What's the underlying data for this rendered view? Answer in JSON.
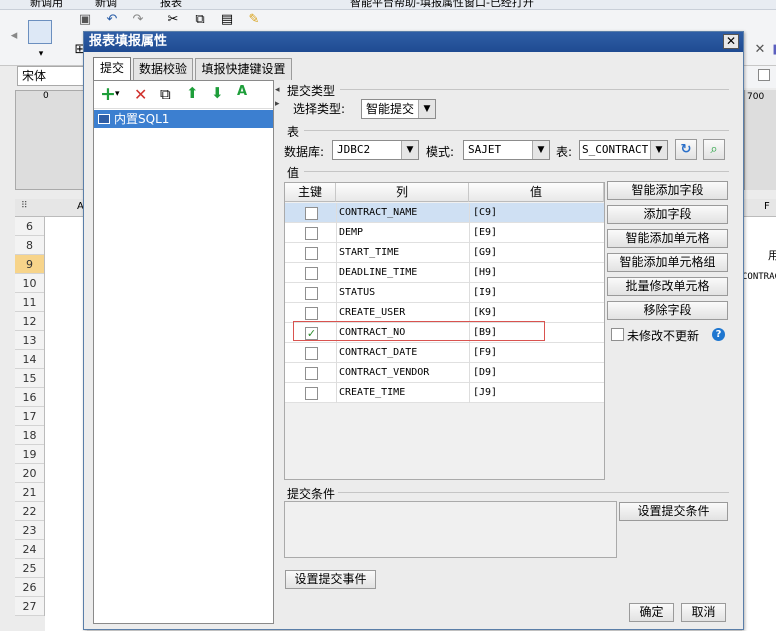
{
  "app": {
    "menu_items": [
      "新调用",
      "新调",
      "报表"
    ],
    "title_text": "智能平台帮助-填报属性窗口-已经打开",
    "font_name": "宋体",
    "ruler_left": "0",
    "ruler_right": "700",
    "col_a": "A",
    "col_f": "F",
    "right_cell_1": "用",
    "right_cell_2": "CONTRAC",
    "row_numbers": [
      "6",
      "8",
      "9",
      "10",
      "11",
      "12",
      "13",
      "14",
      "15",
      "16",
      "17",
      "18",
      "19",
      "20",
      "21",
      "22",
      "23",
      "24",
      "25",
      "26",
      "27"
    ],
    "selected_row": "9"
  },
  "dialog": {
    "title": "报表填报属性",
    "close_glyph": "✕",
    "tabs": [
      {
        "label": "提交",
        "active": true
      },
      {
        "label": "数据校验",
        "active": false
      },
      {
        "label": "填报快捷键设置",
        "active": false
      }
    ],
    "left_toolbar": {
      "add": "+",
      "add_arrow": "▾",
      "delete": "✕",
      "copy": "⧉",
      "up": "⬆",
      "down": "⬇",
      "rename": "A"
    },
    "tree_item": "内置SQL1",
    "submit_type": {
      "group_label": "提交类型",
      "field_label": "选择类型:",
      "value": "智能提交"
    },
    "table_section": {
      "group_label": "表",
      "db_label": "数据库:",
      "db_value": "JDBC2",
      "mode_label": "模式:",
      "mode_value": "SAJET",
      "table_label": "表:",
      "table_value": "S_CONTRACT"
    },
    "values_section": {
      "group_label": "值",
      "headers": {
        "key": "主键",
        "column": "列",
        "value": "值"
      },
      "rows": [
        {
          "checked": false,
          "column": "CONTRACT_NAME",
          "value": "[C9]",
          "selected": true
        },
        {
          "checked": false,
          "column": "DEMP",
          "value": "[E9]",
          "selected": false
        },
        {
          "checked": false,
          "column": "START_TIME",
          "value": "[G9]",
          "selected": false
        },
        {
          "checked": false,
          "column": "DEADLINE_TIME",
          "value": "[H9]",
          "selected": false
        },
        {
          "checked": false,
          "column": "STATUS",
          "value": "[I9]",
          "selected": false
        },
        {
          "checked": false,
          "column": "CREATE_USER",
          "value": "[K9]",
          "selected": false
        },
        {
          "checked": true,
          "column": "CONTRACT_NO",
          "value": "[B9]",
          "selected": false
        },
        {
          "checked": false,
          "column": "CONTRACT_DATE",
          "value": "[F9]",
          "selected": false
        },
        {
          "checked": false,
          "column": "CONTRACT_VENDOR",
          "value": "[D9]",
          "selected": false
        },
        {
          "checked": false,
          "column": "CREATE_TIME",
          "value": "[J9]",
          "selected": false
        }
      ],
      "buttons": {
        "smart_add_field": "智能添加字段",
        "add_field": "添加字段",
        "smart_add_cell": "智能添加单元格",
        "smart_add_cell_group": "智能添加单元格组",
        "batch_edit_cell": "批量修改单元格",
        "remove_field": "移除字段"
      },
      "no_update_label": "未修改不更新",
      "help_glyph": "?"
    },
    "submit_condition": {
      "group_label": "提交条件",
      "set_button": "设置提交条件"
    },
    "set_event_button": "设置提交事件",
    "ok_button": "确定",
    "cancel_button": "取消"
  },
  "colors": {
    "title_bar": "#2f5ea6",
    "selection": "#3c7fd0",
    "row_selected": "#cfe0f3",
    "highlight_box": "#d9534f",
    "green_arrow": "#1e9e3a",
    "red_x": "#d0312d"
  }
}
